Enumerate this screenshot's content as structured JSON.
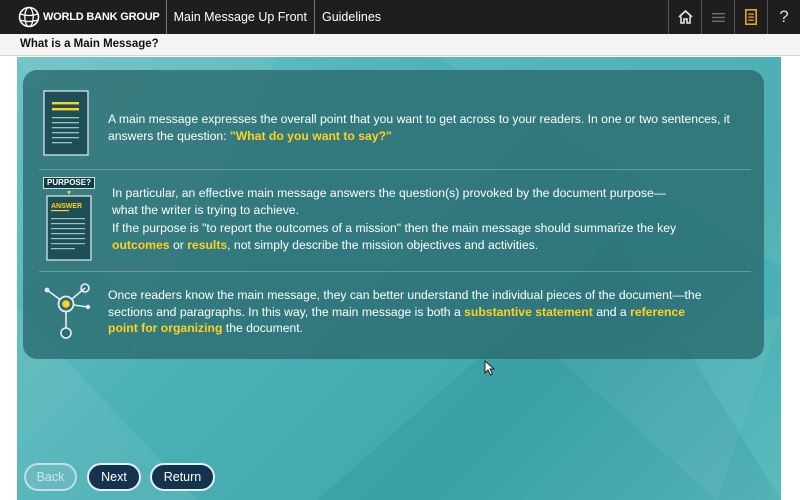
{
  "header": {
    "logo_text": "WORLD BANK GROUP",
    "breadcrumbs": [
      "Main Message Up Front",
      "Guidelines"
    ],
    "icons": [
      "home-icon",
      "menu-icon",
      "notes-icon",
      "help-icon"
    ],
    "help_glyph": "?"
  },
  "subheader": {
    "title": "What is a Main Message?"
  },
  "sections": [
    {
      "icon": "document-lines-icon",
      "text_pre": "A main message expresses the overall point that you want to get across to your readers. In one or two sentences, it answers the question: ",
      "highlight": "\"What do you want to say?\""
    },
    {
      "icon": "purpose-answer-icon",
      "icon_label_top": "PURPOSE?",
      "icon_label_answer": "ANSWER",
      "line1": "In particular, an effective main message answers the question(s) provoked by the document purpose—what the writer is trying to achieve.",
      "line2_pre": "If the purpose is \"to report the outcomes of a mission\" then the main message should summarize the key ",
      "line2_hl1": "outcomes",
      "line2_mid": " or ",
      "line2_hl2": "results",
      "line2_post": ", not simply describe the mission objectives and activities."
    },
    {
      "icon": "network-nodes-icon",
      "text_pre": "Once readers know the main message, they can better understand the individual pieces of the document—the sections and paragraphs. In this way, the main message is both a ",
      "hl1": "substantive statement",
      "mid": " and a ",
      "hl2": "reference point for organizing",
      "post": " the document."
    }
  ],
  "navigation": {
    "back_label": "Back",
    "next_label": "Next",
    "return_label": "Return",
    "back_enabled": false
  },
  "colors": {
    "topbar": "#1e1e1e",
    "teal_background": "#4ab1b5",
    "panel": "#2c6c72",
    "highlight": "#ffd21f",
    "button": "#14334f"
  }
}
